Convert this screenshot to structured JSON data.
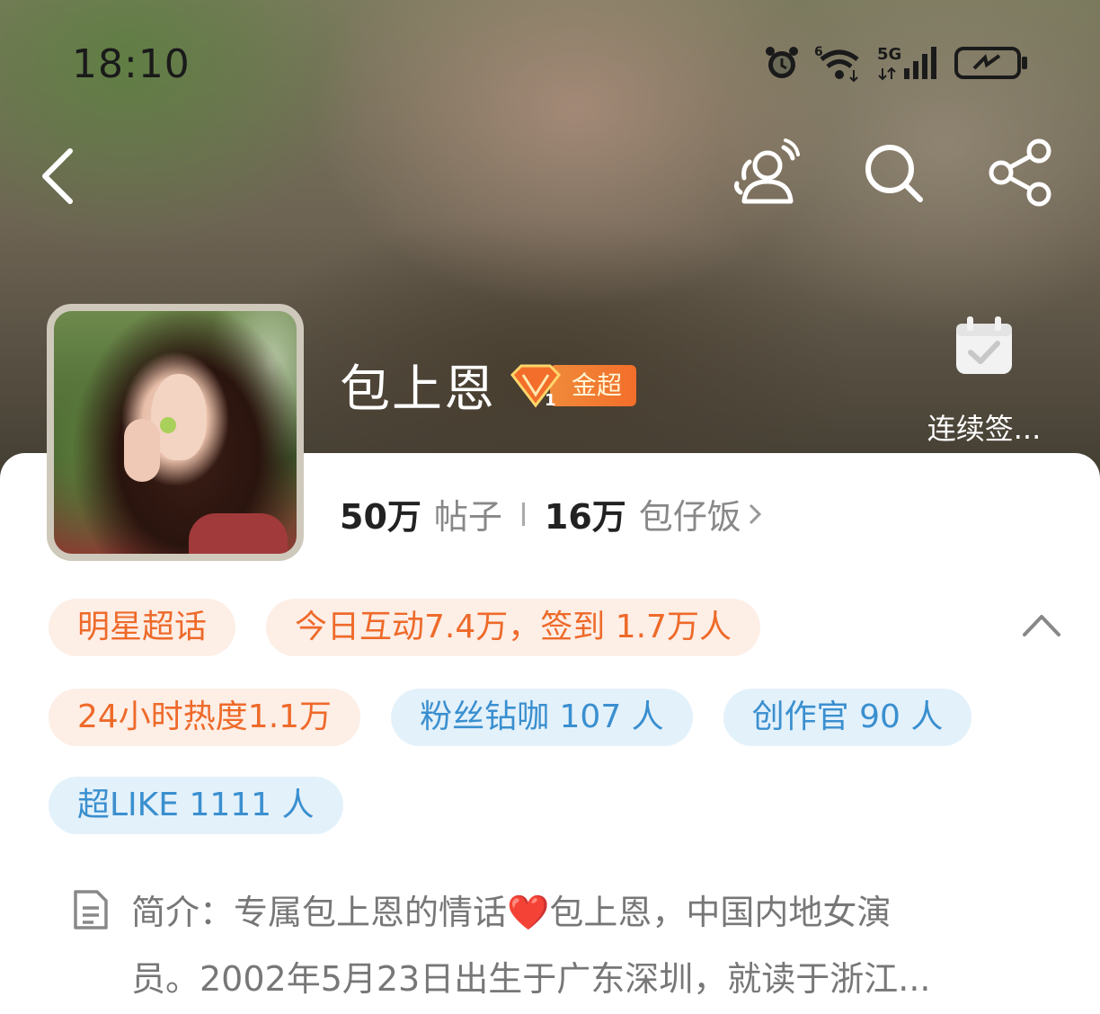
{
  "status_bar": {
    "time": "18:10",
    "network_label": "5G",
    "wifi_superscript": "6"
  },
  "header": {
    "title": "包上恩",
    "badge_label": "金超",
    "badge_level": "1",
    "checkin_label": "连续签..."
  },
  "stats": {
    "posts_count": "50万",
    "posts_label": "帖子",
    "fans_count": "16万",
    "fans_label": "包仔饭"
  },
  "tags": {
    "row1": [
      "明星超话",
      "今日互动7.4万，签到 1.7万人"
    ],
    "row2": [
      "24小时热度1.1万",
      "粉丝钻咖 107 人",
      "创作官 90 人"
    ],
    "row3": [
      "超LIKE 1111 人"
    ]
  },
  "intro": {
    "prefix": "简介：专属包上恩的情话",
    "heart": "❤️",
    "rest": "包上恩，中国内地女演",
    "line2": "员。2002年5月23日出生于广东深圳，就读于浙江..."
  },
  "icons": [
    "back-icon",
    "community-icon",
    "search-icon",
    "share-icon",
    "calendar-check-icon",
    "document-icon",
    "chevron-up-icon",
    "chevron-right-icon"
  ],
  "colors": {
    "tag_orange_bg": "#fdeee6",
    "tag_orange_text": "#ee6a2a",
    "tag_blue_bg": "#e3f1fb",
    "tag_blue_text": "#3a8fcf",
    "badge_orange": "#f26e2a"
  }
}
